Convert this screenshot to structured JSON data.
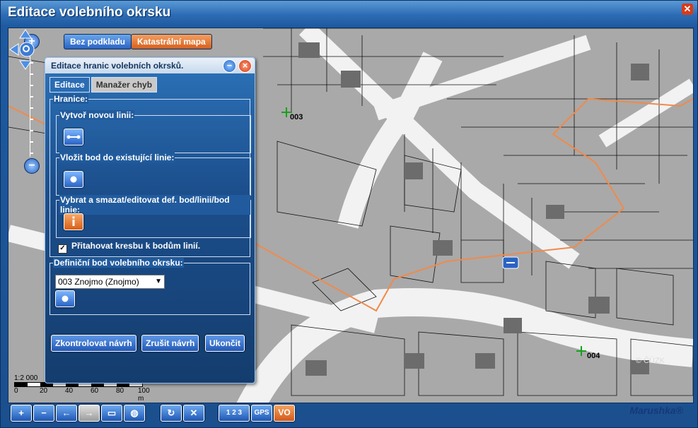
{
  "window": {
    "title": "Editace volebního okrsku"
  },
  "basemap": {
    "no_base_label": "Bez podkladu",
    "cadastral_label": "Katastrální mapa"
  },
  "panel": {
    "title": "Editace hranic volebních okrsků.",
    "tabs": [
      {
        "label": "Editace"
      },
      {
        "label": "Manažer chyb"
      }
    ],
    "boundaries_legend": "Hranice:",
    "create_line_legend": "Vytvoř novou linii:",
    "insert_point_legend": "Vložit bod do existující linie:",
    "select_delete_legend": "Vybrat a smazat/editovat def. bod/linii/bod linie:",
    "snap_checkbox_label": "Přitahovat kresbu k bodům linií.",
    "snap_checked": true,
    "def_point_legend": "Definiční bod volebního okrsku:",
    "district_select_value": "003 Znojmo (Znojmo)",
    "buttons": {
      "check": "Zkontrolovat návrh",
      "cancel": "Zrušit návrh",
      "finish": "Ukončit"
    }
  },
  "map": {
    "district_labels": [
      "003",
      "004"
    ],
    "scale_text": "1:2 000",
    "scale_ticks": [
      "0",
      "20",
      "40",
      "60",
      "80",
      "100 m"
    ],
    "watermark": "© ČÚZK"
  },
  "toolbar": {
    "gps_label": "GPS",
    "vo_label": "VO",
    "counter_label": "1 2 3"
  },
  "brand": "Marushka®",
  "colors": {
    "accent": "#2a63c4",
    "boundary": "#f08a4b",
    "map_bg": "#a9a9a9"
  }
}
